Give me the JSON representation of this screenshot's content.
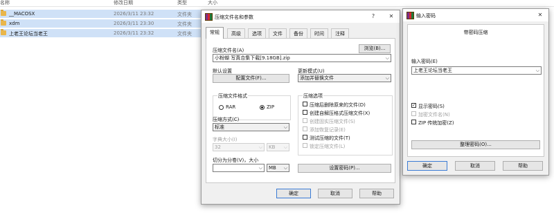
{
  "explorer": {
    "headers": {
      "name": "名称",
      "date": "修改日期",
      "type": "类型",
      "size": "大小"
    },
    "rows": [
      {
        "name": "__MACOSX",
        "date": "2026/3/11 23:32",
        "type": "文件夹"
      },
      {
        "name": "xdm",
        "date": "2026/3/11 23:30",
        "type": "文件夹"
      },
      {
        "name": "上老王论坛当老王",
        "date": "2026/3/11 23:32",
        "type": "文件夹"
      }
    ]
  },
  "archive_dialog": {
    "title": "压缩文件名和参数",
    "help": "?",
    "close": "✕",
    "tabs": [
      "常规",
      "高级",
      "选项",
      "文件",
      "备份",
      "时间",
      "注释"
    ],
    "archive_name_label": "压缩文件名(A)",
    "browse": "浏览(B)...",
    "archive_name": "小粉蝴 写真合集下载[9.18GB].zip",
    "default_settings_label": "默认设置",
    "profiles": "配置文件(F)...",
    "update_mode_label": "更新模式(U)",
    "update_mode": "添加并替换文件",
    "format_label": "压缩文件格式",
    "format_rar": "RAR",
    "format_zip": "ZIP",
    "options_label": "压缩选项",
    "options": [
      {
        "label": "压缩后删除原来的文件(D)",
        "checked": false,
        "disabled": false
      },
      {
        "label": "创建自解压格式压缩文件(X)",
        "checked": false,
        "disabled": false
      },
      {
        "label": "创建固实压缩文件(S)",
        "checked": false,
        "disabled": true
      },
      {
        "label": "添加恢复记录(E)",
        "checked": false,
        "disabled": true
      },
      {
        "label": "测试压缩的文件(T)",
        "checked": false,
        "disabled": false
      },
      {
        "label": "锁定压缩文件(L)",
        "checked": false,
        "disabled": true
      }
    ],
    "method_label": "压缩方式(C)",
    "method": "标准",
    "dict_label": "字典大小(I)",
    "dict_value": "32",
    "dict_unit": "KB",
    "split_label": "切分为分卷(V)，大小",
    "split_unit": "MB",
    "set_password": "设置密码(P)...",
    "ok": "确定",
    "cancel": "取消",
    "help_btn": "帮助"
  },
  "password_dialog": {
    "title": "输入密码",
    "close": "✕",
    "header": "带密码压缩",
    "password_label": "输入密码(E)",
    "password_value": "上老王论坛当老王",
    "show_password": "显示密码(S)",
    "encrypt_names": "加密文件名(N)",
    "zip_legacy": "ZIP 传统加密(Z)",
    "organize": "整理密码(O)...",
    "ok": "确定",
    "cancel": "取消",
    "help_btn": "帮助"
  },
  "colors": {
    "selection": "#cfe1f7",
    "folder": "#e9b64b",
    "default_border": "#3a7bd5"
  }
}
